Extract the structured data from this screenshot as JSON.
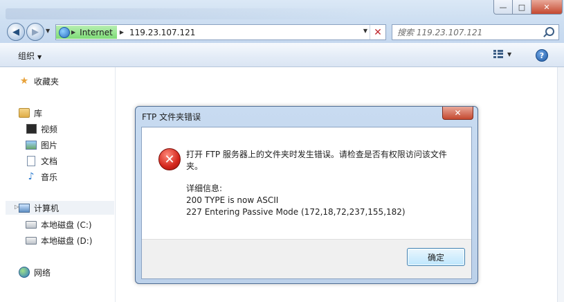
{
  "window": {
    "minimize_label": "—",
    "maximize_label": "□",
    "close_label": "✕"
  },
  "nav": {
    "address_root": "Internet",
    "address_path": "119.23.107.121",
    "search_placeholder": "搜索 119.23.107.121"
  },
  "toolbar": {
    "organize_label": "组织",
    "help_label": "?"
  },
  "sidebar": {
    "favorites": "收藏夹",
    "libraries": "库",
    "videos": "视频",
    "pictures": "图片",
    "documents": "文档",
    "music": "音乐",
    "computer": "计算机",
    "drive_c": "本地磁盘 (C:)",
    "drive_d": "本地磁盘 (D:)",
    "network": "网络"
  },
  "dialog": {
    "title": "FTP 文件夹错误",
    "close_label": "✕",
    "message": "打开 FTP 服务器上的文件夹时发生错误。请检查是否有权限访问该文件夹。",
    "detail_heading": "详细信息:",
    "detail_line1": "200 TYPE is now ASCII",
    "detail_line2": "227 Entering Passive Mode (172,18,72,237,155,182)",
    "ok_label": "确定"
  },
  "colors": {
    "error_red": "#d3261c",
    "accent_blue": "#3c7fb1",
    "address_green": "#7fdc77"
  }
}
